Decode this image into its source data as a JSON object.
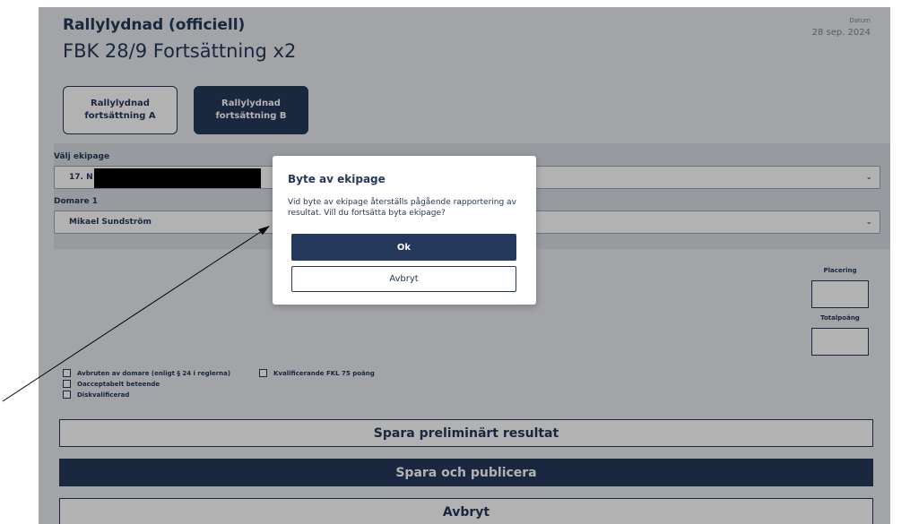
{
  "header": {
    "org_title": "Rallylydnad (officiell)",
    "page_title": "FBK 28/9 Fortsättning x2",
    "date_label": "Datum",
    "date_value": "28 sep. 2024"
  },
  "tabs": [
    {
      "label": "Rallylydnad\nfortsättning A",
      "active": false
    },
    {
      "label": "Rallylydnad\nfortsättning B",
      "active": true
    }
  ],
  "form": {
    "ekipage_label": "Välj ekipage",
    "ekipage_value": "17. N",
    "domare_label": "Domare 1",
    "domare_value": "Mikael Sundström"
  },
  "side": {
    "placering_label": "Placering",
    "totalpoang_label": "Totalpoäng"
  },
  "checkboxes": [
    {
      "label": "Avbruten av domare (enligt § 24 i reglerna)",
      "checked": false
    },
    {
      "label": "Oacceptabelt beteende",
      "checked": false
    },
    {
      "label": "Diskvalificerad",
      "checked": false
    },
    {
      "label": "Kvalificerande FKL 75 poäng",
      "checked": false
    }
  ],
  "buttons": {
    "save_preliminary": "Spara preliminärt resultat",
    "save_publish": "Spara och publicera",
    "cancel": "Avbryt"
  },
  "modal": {
    "title": "Byte av ekipage",
    "text": "Vid byte av ekipage återställs pågående rapportering av resultat. Vill du fortsätta byta ekipage?",
    "ok_label": "Ok",
    "cancel_label": "Avbryt"
  },
  "colors": {
    "primary": "#24385b",
    "page_background": "#e8ebef",
    "panel_background": "#d9dee5"
  },
  "icons": {
    "dropdown": "chevron-down-icon"
  }
}
